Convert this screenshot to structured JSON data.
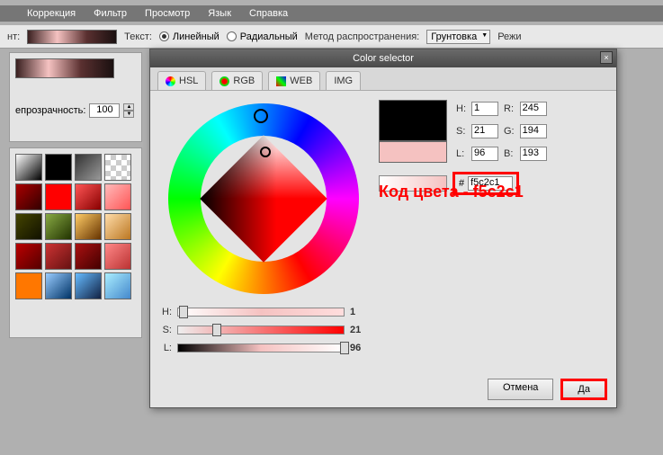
{
  "menu": {
    "items": [
      "Коррекция",
      "Фильтр",
      "Просмотр",
      "Язык",
      "Справка"
    ]
  },
  "toolbar": {
    "label_nt": "нт:",
    "text_label": "Текст:",
    "radio_linear": "Линейный",
    "radio_radial": "Радиальный",
    "method_label": "Метод распространения:",
    "method_value": "Грунтовка",
    "regime_label": "Режи"
  },
  "left": {
    "opacity_label": "епрозрачность:",
    "opacity_value": "100"
  },
  "dialog": {
    "title": "Color selector",
    "tabs": {
      "hsl": "HSL",
      "rgb": "RGB",
      "web": "WEB",
      "img": "IMG"
    },
    "sliders": {
      "h_label": "H:",
      "h_val": "1",
      "s_label": "S:",
      "s_val": "21",
      "l_label": "L:",
      "l_val": "96"
    },
    "fields": {
      "h_label": "H:",
      "h_val": "1",
      "s_label": "S:",
      "s_val": "21",
      "l_label": "L:",
      "l_val": "96",
      "r_label": "R:",
      "r_val": "245",
      "g_label": "G:",
      "g_val": "194",
      "b_label": "B:",
      "b_val": "193",
      "hash": "#",
      "hex": "f5c2c1"
    },
    "buttons": {
      "cancel": "Отмена",
      "ok": "Да"
    }
  },
  "annotation": "Код цвета - f5c2c1",
  "swatches": [
    "linear-gradient(135deg,#fff,#000)",
    "linear-gradient(135deg,#000,#000)",
    "linear-gradient(135deg,#333,#999)",
    "checker",
    "linear-gradient(135deg,#a00,#300)",
    "#f00",
    "linear-gradient(135deg,#f55,#800)",
    "linear-gradient(135deg,#fbb,#f55)",
    "linear-gradient(135deg,#440,#110)",
    "linear-gradient(135deg,#8a4,#230)",
    "linear-gradient(135deg,#fc6,#630)",
    "linear-gradient(135deg,#fda,#b72)",
    "linear-gradient(135deg,#b00,#500)",
    "linear-gradient(135deg,#c33,#611)",
    "linear-gradient(135deg,#a11,#400)",
    "linear-gradient(135deg,#f88,#b33)",
    "#f70",
    "linear-gradient(135deg,#9cf,#036)",
    "linear-gradient(135deg,#6bf,#124)",
    "linear-gradient(135deg,#aef,#48c)"
  ]
}
